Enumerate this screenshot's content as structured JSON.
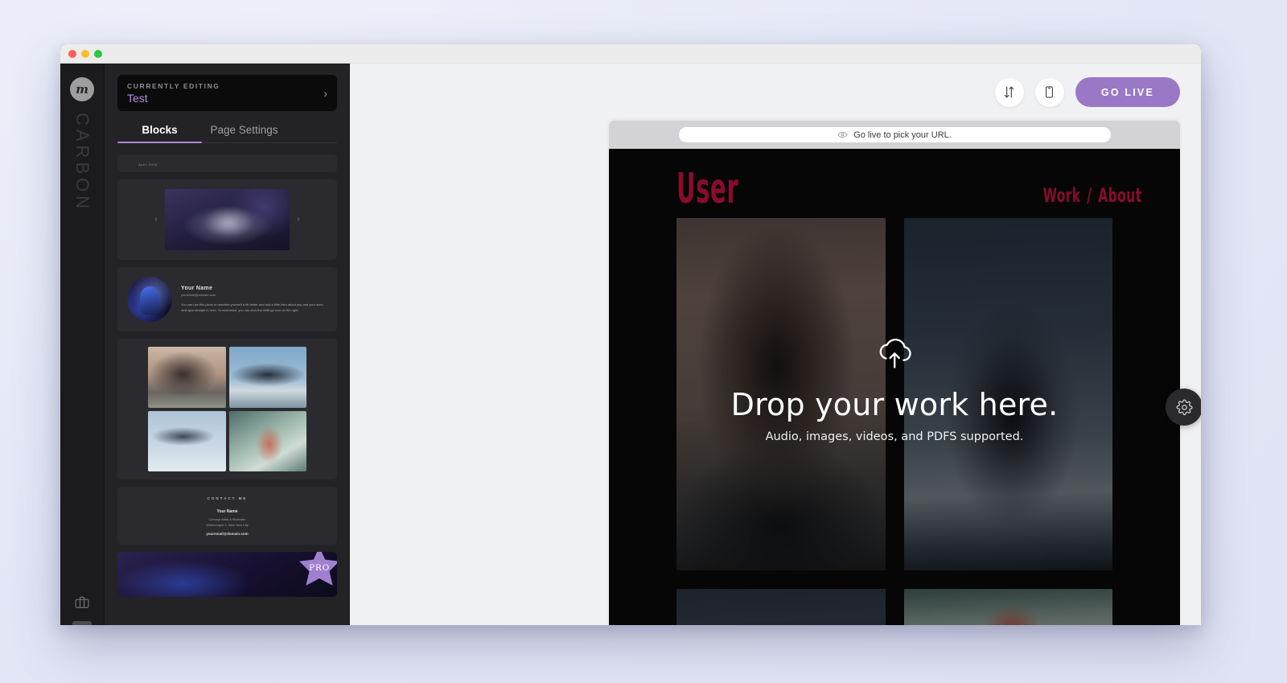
{
  "window": {
    "traffic_lights": [
      "close",
      "minimize",
      "maximize"
    ]
  },
  "rail": {
    "logo_letter": "m",
    "brand": "CARBON",
    "portfolio_icon": "briefcase-icon"
  },
  "left_panel": {
    "editing_label": "CURRENTLY EDITING",
    "editing_value": "Test",
    "chevron": "›",
    "tabs": [
      {
        "label": "Blocks",
        "active": true
      },
      {
        "label": "Page Settings",
        "active": false
      }
    ],
    "blocks": [
      {
        "type": "partial",
        "caption": "April, 2018"
      },
      {
        "type": "carousel",
        "prev": "‹",
        "next": "›"
      },
      {
        "type": "about",
        "name": "Your Name",
        "email": "youremail@domain.com",
        "body": "You can use this place to describe yourself a bit better and add a little intro about you and your work. Just type straight in here. To customize, you can click the settings icon on the right."
      },
      {
        "type": "grid4"
      },
      {
        "type": "contact",
        "title": "CONTACT ME",
        "name": "Your Name",
        "role": "Concept Artist & Illustrator",
        "location": "Whitechapel 2, New York City",
        "email": "youremail@domain.com"
      },
      {
        "type": "pro",
        "badge": "PRO"
      }
    ]
  },
  "toolbar": {
    "reorder_icon": "sort-arrows-icon",
    "mobile_icon": "mobile-preview-icon",
    "go_live_label": "GO LIVE"
  },
  "preview": {
    "url_placeholder": "Go live to pick your URL.",
    "eye_icon": "eye-icon",
    "site": {
      "logo": "User",
      "nav": [
        "Work",
        "/",
        "About"
      ]
    },
    "drop_zone": {
      "icon": "cloud-upload-icon",
      "title": "Drop your work here.",
      "subtitle": "Audio, images, videos, and PDFS supported."
    }
  },
  "settings_tab": {
    "icon": "gear-icon"
  },
  "colors": {
    "accent_purple": "#9a78c6",
    "site_accent": "#f4114c",
    "panel_bg": "#232326",
    "rail_bg": "#1b1b1d",
    "editor_bg": "#f0f1f3"
  }
}
